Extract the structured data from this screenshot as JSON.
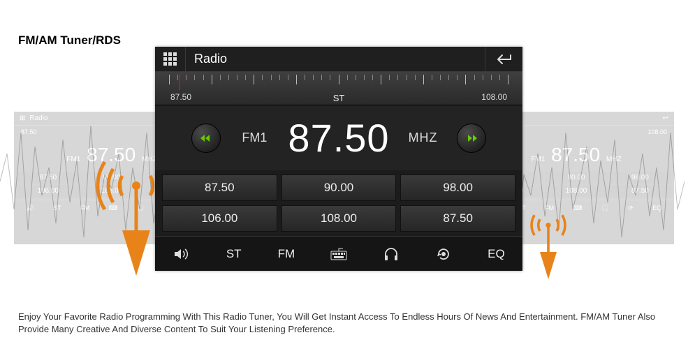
{
  "page": {
    "title": "FM/AM Tuner/RDS",
    "description": "Enjoy Your Favorite Radio Programming With This Radio Tuner, You Will Get Instant Access To Endless  Hours Of News And Entertainment. FM/AM Tuner Also Provide Many Creative And Diverse Content To Suit Your Listening Preference."
  },
  "radio": {
    "header_title": "Radio",
    "dial": {
      "min_label": "87.50",
      "max_label": "108.00",
      "stereo_label": "ST"
    },
    "tuner": {
      "band": "FM1",
      "frequency": "87.50",
      "unit": "MHZ"
    },
    "presets": [
      "87.50",
      "90.00",
      "98.00",
      "106.00",
      "108.00",
      "87.50"
    ],
    "bottombar": {
      "st": "ST",
      "fm": "FM",
      "eq": "EQ"
    }
  },
  "bg_radio": {
    "header_title": "Radio",
    "min_label": "87.50",
    "max_label": "108.00",
    "band": "FM1",
    "frequency": "87.50",
    "unit": "MHZ",
    "presets": [
      "87.50",
      "90.00",
      "98.00",
      "106.00",
      "108.00",
      "87.50"
    ],
    "st": "ST",
    "fm": "FM",
    "eq": "EQ"
  }
}
